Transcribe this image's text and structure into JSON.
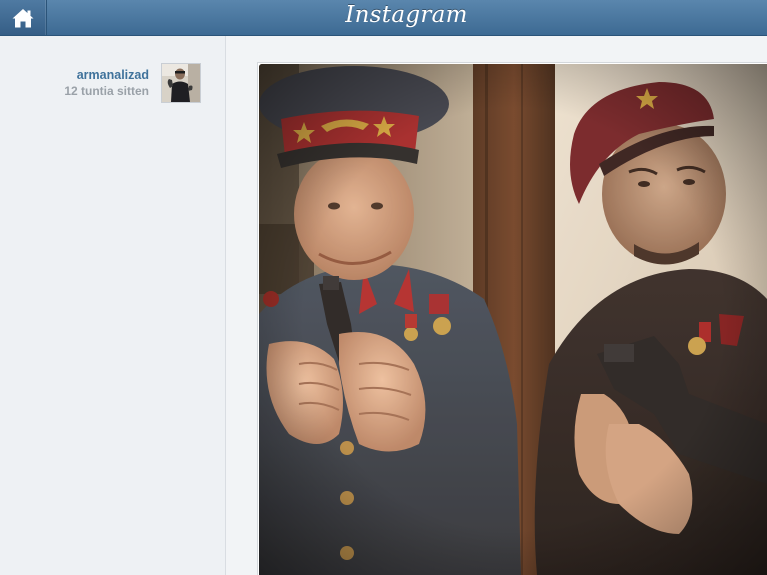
{
  "header": {
    "brand": "Instagram",
    "home_icon": "home-icon"
  },
  "post": {
    "username": "armanalizad",
    "timestamp": "12 tuntia sitten",
    "avatar_icon": "user-avatar",
    "photo_description_icon": "photo"
  },
  "colors": {
    "header_top": "#5a86ad",
    "header_bottom": "#3d6a93",
    "username": "#3f729b",
    "timestamp": "#9aa1a8",
    "background": "#eef1f4"
  }
}
